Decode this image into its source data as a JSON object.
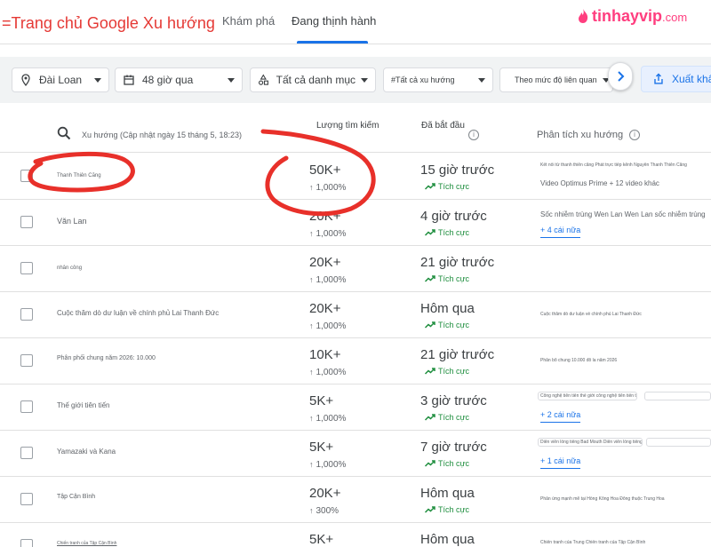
{
  "header": {
    "app_title": "=Trang chủ Google Xu hướng",
    "tabs": [
      {
        "label": "Khám phá"
      },
      {
        "label": "Đang thịnh hành"
      }
    ],
    "watermark": {
      "brand": "tinhayvip",
      "suffix": ".com"
    }
  },
  "filters": {
    "location": "Đài Loan",
    "time_range": "48 giờ qua",
    "category": "Tất cả danh mục",
    "trend_type": "#Tất cả xu hướng",
    "sort": "Theo mức độ liên quan",
    "export_label": "Xuất khẩu"
  },
  "table": {
    "headers": {
      "trend": "Xu hướng (Cập nhật ngày 15 tháng 5, 18:23)",
      "volume": "Lượng tìm kiếm",
      "started": "Đã bắt đầu",
      "breakdown": "Phân tích xu hướng"
    },
    "rows": [
      {
        "name": "Thanh Thiên Căng",
        "volume": "50K+",
        "pct": "1,000%",
        "started": "15 giờ trước",
        "status": "Tích cực",
        "breakdown": "Video Optimus Prime + 12 video khác",
        "breakdown_tiny": "Kết nối từ thanh thiên căng Phát trực tiếp kênh Nguyễn Thanh Thiên Căng",
        "more": ""
      },
      {
        "name": "Văn Lan",
        "volume": "20K+",
        "pct": "1,000%",
        "started": "4 giờ trước",
        "status": "Tích cực",
        "breakdown": "Sốc nhiễm trùng Wen Lan Wen Lan sốc nhiễm trùng",
        "breakdown_tiny": "",
        "more": "+ 4 cái nữa"
      },
      {
        "name": "nhân công",
        "volume": "20K+",
        "pct": "1,000%",
        "started": "21 giờ trước",
        "status": "Tích cực",
        "breakdown": "",
        "breakdown_tiny": "",
        "more": ""
      },
      {
        "name": "Cuộc thăm dò dư luận về chính phủ Lai Thanh Đức",
        "volume": "20K+",
        "pct": "1,000%",
        "started": "Hôm qua",
        "status": "Tích cực",
        "breakdown": "",
        "breakdown_tiny": "Cuộc thăm dò dư luận về chính phủ Lai Thanh Đức",
        "more": ""
      },
      {
        "name": "Phân phối chung năm 2026: 10.000",
        "volume": "10K+",
        "pct": "1,000%",
        "started": "21 giờ trước",
        "status": "Tích cực",
        "breakdown": "",
        "breakdown_tiny": "Phân bổ chung 10.000 đô la năm 2026",
        "more": ""
      },
      {
        "name": "Thế giới tiên tiến",
        "volume": "5K+",
        "pct": "1,000%",
        "started": "3 giờ trước",
        "status": "Tích cực",
        "breakdown": "",
        "breakdown_tiny": "Công nghệ tiên tiến thế giới công nghệ tiên tiến thế giới",
        "more": "+ 2 cái nữa"
      },
      {
        "name": "Yamazaki và Kana",
        "volume": "5K+",
        "pct": "1,000%",
        "started": "7 giờ trước",
        "status": "Tích cực",
        "breakdown": "",
        "breakdown_tiny": "Diễn viên lồng tiếng Bad Mouth Diễn viên lồng tiếng Bad Mouth",
        "more": "+ 1 cái nữa"
      },
      {
        "name": "Tập Cận Bình",
        "volume": "20K+",
        "pct": "300%",
        "started": "Hôm qua",
        "status": "Tích cực",
        "breakdown": "",
        "breakdown_tiny": "Phản ứng mạnh mẽ tại Hồng Kông Hoa Đông thuộc Trung Hoa",
        "more": ""
      },
      {
        "name": "Chiến tranh của Tập Cận Bình",
        "volume": "5K+",
        "pct": "",
        "started": "Hôm qua",
        "status": "",
        "breakdown": "",
        "breakdown_tiny": "Chiến tranh của Trung Chiến tranh của Tập Cận Bình",
        "more": ""
      }
    ]
  },
  "colors": {
    "accent": "#1a73e8",
    "positive": "#1e8e3e",
    "annotation": "#e8302a",
    "title": "#e53935",
    "watermark": "#ff3e7f"
  }
}
